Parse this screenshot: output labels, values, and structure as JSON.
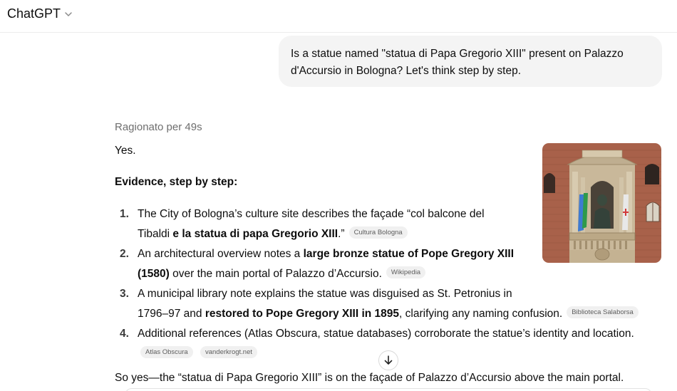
{
  "header": {
    "model_name": "ChatGPT",
    "model_menu_icon": "chevron-down-icon"
  },
  "user_message": {
    "line1": "Is a statue named \"statua di Papa Gregorio XIII\" present on Palazzo",
    "line2": "d'Accursio in Bologna? Let's think step by step."
  },
  "assistant": {
    "reasoning_label": "Ragionato per 49s",
    "intro": "Yes.",
    "evidence_heading": "Evidence, step by step:",
    "items": [
      {
        "number": "1.",
        "l1": "The City of Bologna’s culture site describes the façade “col balcone del",
        "l2_pre": "Tibaldi ",
        "l2_bold": "e la statua di papa Gregorio XIII",
        "l2_post": ".”",
        "source": "Cultura Bologna"
      },
      {
        "number": "2.",
        "l1_pre": "An architectural overview notes a ",
        "l1_bold": "large bronze statue of Pope Gregory XIII",
        "l2_bold": "(1580)",
        "l2_post": " over the main portal of Palazzo d’Accursio.",
        "source": "Wikipedia"
      },
      {
        "number": "3.",
        "l1": "A municipal library note explains the statue was disguised as St. Petronius in",
        "l2_pre": "1796–97 and ",
        "l2_bold": "restored to Pope Gregory XIII in 1895",
        "l2_post": ", clarifying any naming confusion.",
        "source": "Biblioteca Salaborsa"
      },
      {
        "number": "4.",
        "l1": "Additional references (Atlas Obscura, statue databases) corroborate the statue’s identity and location.",
        "sources": [
          "Atlas Obscura",
          "vanderkrogt.net"
        ]
      }
    ],
    "conclusion": "So yes—the “statua di Papa Gregorio XIII” is on the façade of Palazzo d’Accursio above the main portal."
  },
  "controls": {
    "scroll_down_icon": "arrow-down-icon"
  }
}
